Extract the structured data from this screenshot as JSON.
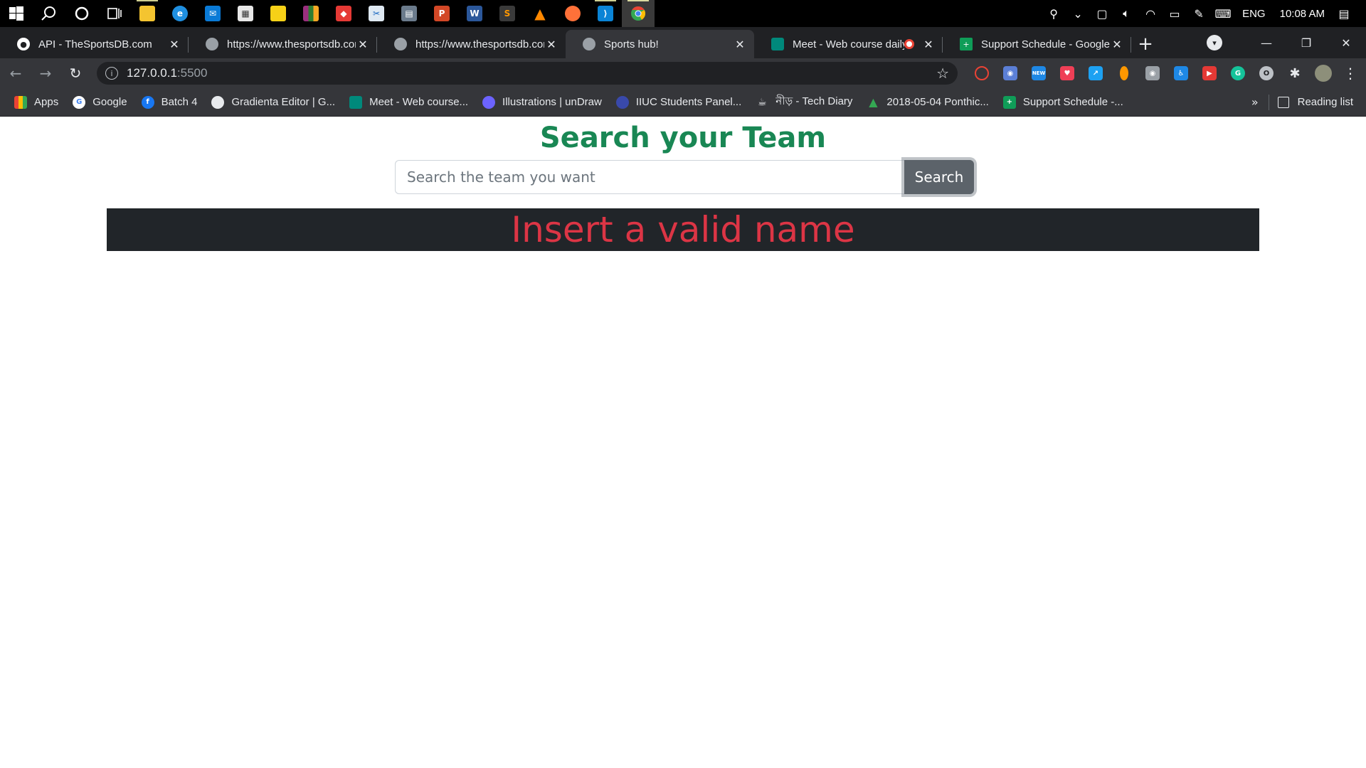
{
  "taskbar": {
    "apps": [
      {
        "name": "start-icon"
      },
      {
        "name": "search-icon"
      },
      {
        "name": "cortana-icon"
      },
      {
        "name": "task-view-icon"
      },
      {
        "name": "file-explorer-icon",
        "color": "#f4c430"
      },
      {
        "name": "edge-icon",
        "color": "#1f8fe0"
      },
      {
        "name": "mail-icon",
        "color": "#0a7ad6"
      },
      {
        "name": "store-icon",
        "color": "#e8e8e8"
      },
      {
        "name": "sticky-notes-icon",
        "color": "#f7d117"
      },
      {
        "name": "winrar-icon",
        "color": "#9b2f7e"
      },
      {
        "name": "anydesk-icon",
        "color": "#e53935"
      },
      {
        "name": "snipping-icon",
        "color": "#dfe9f2"
      },
      {
        "name": "calculator-icon",
        "color": "#6b7b8c"
      },
      {
        "name": "powerpoint-icon",
        "color": "#d24726"
      },
      {
        "name": "word-icon",
        "color": "#2b579a"
      },
      {
        "name": "sublime-icon",
        "color": "#3a3a3a"
      },
      {
        "name": "vlc-icon",
        "color": "#ff8800"
      },
      {
        "name": "firefox-icon",
        "color": "#ff7139"
      },
      {
        "name": "vscode-icon",
        "color": "#0a84d6"
      },
      {
        "name": "chrome-icon",
        "color": "#34a853"
      }
    ],
    "tray": {
      "language": "ENG",
      "time": "10:08 AM"
    }
  },
  "tabs": [
    {
      "title": "API - TheSportsDB.com",
      "favicon_color": "#ffffff"
    },
    {
      "title": "https://www.thesportsdb.com",
      "favicon_color": "#9aa0a6"
    },
    {
      "title": "https://www.thesportsdb.com",
      "favicon_color": "#9aa0a6"
    },
    {
      "title": "Sports hub!",
      "favicon_color": "#9aa0a6",
      "active": true
    },
    {
      "title": "Meet - Web course daily",
      "favicon_color": "#00897b",
      "recording": true
    },
    {
      "title": "Support Schedule - Google Sheets",
      "favicon_color": "#0f9d58"
    }
  ],
  "toolbar": {
    "url_host": "127.0.0.1",
    "url_port": ":5500"
  },
  "bookmarks": [
    {
      "label": "Apps",
      "icon": "apps-grid-icon",
      "color": "#ea4335"
    },
    {
      "label": "Google",
      "icon": "google-icon",
      "color": "#4285f4"
    },
    {
      "label": "Batch 4",
      "icon": "facebook-icon",
      "color": "#1877f2"
    },
    {
      "label": "Gradienta Editor | G...",
      "icon": "globe-icon",
      "color": "#e8eaed"
    },
    {
      "label": "Meet - Web course...",
      "icon": "meet-icon",
      "color": "#00897b"
    },
    {
      "label": "Illustrations | unDraw",
      "icon": "undraw-icon",
      "color": "#6c63ff"
    },
    {
      "label": "IIUC Students Panel...",
      "icon": "iiuc-icon",
      "color": "#3949ab"
    },
    {
      "label": "নীড় - Tech Diary",
      "icon": "coffee-icon",
      "color": "#e8eaed"
    },
    {
      "label": "2018-05-04 Ponthic...",
      "icon": "drive-icon",
      "color": "#34a853"
    },
    {
      "label": "Support Schedule -...",
      "icon": "sheets-icon",
      "color": "#0f9d58"
    }
  ],
  "bookmarks_more": "»",
  "reading_list": "Reading list",
  "page": {
    "title": "Search your Team",
    "search_placeholder": "Search the team you want",
    "search_button": "Search",
    "error_message": "Insert a valid name"
  },
  "colors": {
    "title_green": "#198754",
    "error_red": "#dc3545",
    "banner_dark": "#212529",
    "button_gray": "#5c636a"
  }
}
